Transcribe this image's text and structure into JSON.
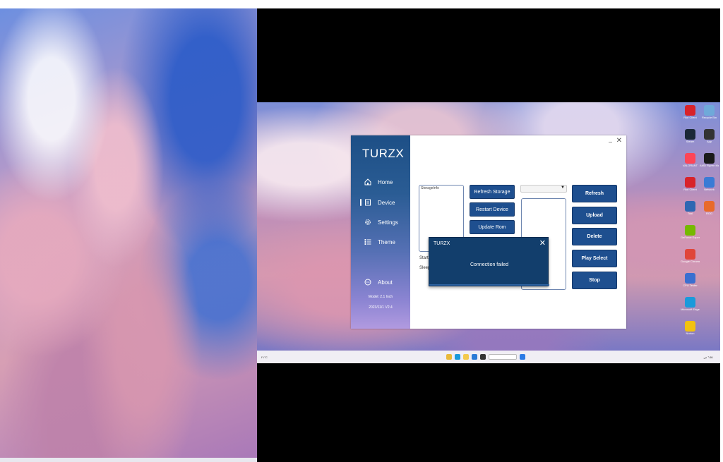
{
  "app": {
    "title": "TURZX",
    "nav": [
      {
        "label": "Home",
        "icon": "home-icon"
      },
      {
        "label": "Device",
        "icon": "device-icon"
      },
      {
        "label": "Settings",
        "icon": "gear-icon"
      },
      {
        "label": "Theme",
        "icon": "list-icon"
      }
    ],
    "about": {
      "label": "About",
      "model": "Model: 2.1 Inch",
      "version": "2023/11/1 V2.4"
    },
    "storage_label": "StorageInfo",
    "start_label": "Start",
    "sleep_label": "Sleep",
    "buttons_mid": [
      "Refresh Storage",
      "Restart Device",
      "Update Rom"
    ],
    "buttons_right": [
      "Refresh",
      "Upload",
      "Delete",
      "Play Select",
      "Stop"
    ],
    "window_minimize": "–",
    "window_close": "✕"
  },
  "dialog": {
    "title": "TURZX",
    "message": "Connection failed",
    "close": "✕"
  },
  "desktop_icons": [
    {
      "label": "Riot Client",
      "color": "#d8232a"
    },
    {
      "label": "Recycle Bin",
      "color": "#6fa9d9"
    },
    {
      "label": "Steam",
      "color": "#1b2838"
    },
    {
      "label": "App",
      "color": "#333333"
    },
    {
      "label": "VALORANT",
      "color": "#fd4556"
    },
    {
      "label": "AMD Ryzen Master",
      "color": "#1a1a1a"
    },
    {
      "label": "Riot Client",
      "color": "#d8232a"
    },
    {
      "label": "Network",
      "color": "#3a7bd5"
    },
    {
      "label": "Tool",
      "color": "#2e67b2"
    },
    {
      "label": "ROG",
      "color": "#e86a2a"
    },
    {
      "label": "GeForce Experience",
      "color": "#76b900"
    },
    {
      "label": "",
      "color": "transparent"
    },
    {
      "label": "Google Chrome",
      "color": "#e0463a"
    },
    {
      "label": "",
      "color": "transparent"
    },
    {
      "label": "CPU Tester",
      "color": "#3a6fd0"
    },
    {
      "label": "",
      "color": "transparent"
    },
    {
      "label": "Microsoft Edge",
      "color": "#1a9adb"
    },
    {
      "label": "",
      "color": "transparent"
    },
    {
      "label": "Norton",
      "color": "#f2c20f"
    }
  ],
  "taskbar": {
    "weather": "٢١°C",
    "clock": "٦:٥٤ ص"
  }
}
